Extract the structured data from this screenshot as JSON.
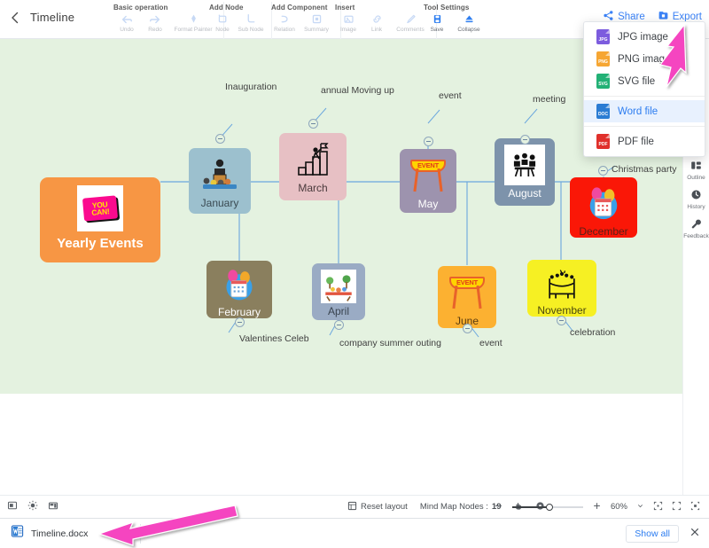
{
  "header": {
    "back_icon": "chevron-left-icon",
    "title": "Timeline",
    "share_label": "Share",
    "export_label": "Export",
    "share_icon": "share-icon",
    "export_icon": "export-folder-icon",
    "groups": [
      {
        "title": "Basic operation",
        "items": [
          {
            "label": "Undo",
            "icon": "undo-arrow-icon",
            "enabled": false
          },
          {
            "label": "Redo",
            "icon": "redo-arrow-icon",
            "enabled": false
          },
          {
            "label": "Format Painter",
            "icon": "format-painter-icon",
            "enabled": false
          }
        ]
      },
      {
        "title": "Add Node",
        "items": [
          {
            "label": "Node",
            "icon": "add-node-icon",
            "enabled": false
          },
          {
            "label": "Sub Node",
            "icon": "add-subnode-icon",
            "enabled": false
          }
        ]
      },
      {
        "title": "Add Component",
        "items": [
          {
            "label": "Relation",
            "icon": "relation-icon",
            "enabled": false
          },
          {
            "label": "Summary",
            "icon": "summary-icon",
            "enabled": false
          }
        ]
      },
      {
        "title": "Insert",
        "items": [
          {
            "label": "Image",
            "icon": "image-icon",
            "enabled": false
          },
          {
            "label": "Link",
            "icon": "link-icon",
            "enabled": false
          },
          {
            "label": "Comments",
            "icon": "comments-icon",
            "enabled": false
          }
        ]
      },
      {
        "title": "Tool Settings",
        "items": [
          {
            "label": "Save",
            "icon": "save-disk-icon",
            "enabled": true
          },
          {
            "label": "Collapse",
            "icon": "collapse-icon",
            "enabled": true
          }
        ]
      }
    ]
  },
  "export_menu": {
    "items": [
      {
        "label": "JPG image",
        "icon": "jpg-file-icon",
        "color": "#7c5cde",
        "tag": "JPG",
        "selected": false
      },
      {
        "label": "PNG image",
        "icon": "png-file-icon",
        "color": "#f6a633",
        "tag": "PNG",
        "selected": false
      },
      {
        "label": "SVG file",
        "icon": "svg-file-icon",
        "color": "#23b176",
        "tag": "SVG",
        "selected": false
      },
      {
        "label": "Word file",
        "icon": "word-file-icon",
        "color": "#2b7cd3",
        "tag": "DOC",
        "selected": true
      },
      {
        "label": "PDF file",
        "icon": "pdf-file-icon",
        "color": "#e0302b",
        "tag": "PDF",
        "selected": false
      }
    ]
  },
  "right_rail": {
    "items": [
      {
        "label": "Outline",
        "icon": "outline-icon"
      },
      {
        "label": "History",
        "icon": "clock-history-icon"
      },
      {
        "label": "Feedback",
        "icon": "wrench-feedback-icon"
      }
    ]
  },
  "mindmap": {
    "central": {
      "label": "Yearly Events",
      "color": "#f79644",
      "image": "you-can-poster"
    },
    "nodes": [
      {
        "label": "January",
        "color": "#9cc0ce",
        "text_color": "#3a4a52",
        "image": "speaker-podium"
      },
      {
        "label": "March",
        "color": "#e7c0c4",
        "text_color": "#4a3a3c",
        "image": "achievement-steps"
      },
      {
        "label": "May",
        "color": "#9d93ae",
        "text_color": "#ffffff",
        "image": "event-banner"
      },
      {
        "label": "August",
        "color": "#7d93ab",
        "text_color": "#ffffff",
        "image": "meeting-people"
      },
      {
        "label": "December",
        "color": "#fa1707",
        "text_color": "#5c2018",
        "image": "calendar-balloons"
      },
      {
        "label": "February",
        "color": "#8a7f5e",
        "text_color": "#ffffff",
        "image": "calendar-balloons"
      },
      {
        "label": "April",
        "color": "#9aabc4",
        "text_color": "#3a4450",
        "image": "picnic-outing"
      },
      {
        "label": "June",
        "color": "#fcb131",
        "text_color": "#5a3b10",
        "image": "event-banner"
      },
      {
        "label": "November",
        "color": "#f6f023",
        "text_color": "#4d4a0e",
        "image": "party-celebration"
      }
    ],
    "annotations": [
      "Inauguration",
      "annual Moving up",
      "event",
      "meeting",
      "Christmas party",
      "Valentines Celeb",
      "company summer outing",
      "event",
      "celebration"
    ]
  },
  "status_bar": {
    "left_icons": [
      "note-panel-icon",
      "theme-brightness-icon",
      "layout-style-icon"
    ],
    "reset_layout_label": "Reset layout",
    "reset_layout_icon": "reset-layout-icon",
    "node_count_label": "Mind Map Nodes :",
    "node_count_value": "19",
    "hand_tool_icon": "hand-tool-icon",
    "pointer-tool_icon": "pointer-tool-icon",
    "zoom_out_icon": "minus-icon",
    "zoom_in_icon": "plus-icon",
    "zoom_value": "60%",
    "zoom_caret_icon": "chevron-down-icon",
    "fit_icon": "fit-screen-icon",
    "fullscreen_icon": "fullscreen-icon",
    "center_icon": "center-view-icon"
  },
  "download_bar": {
    "file_name": "Timeline.docx",
    "file_icon": "word-doc-icon",
    "show_all_label": "Show all",
    "close_icon": "close-icon"
  },
  "colors": {
    "canvas_bg": "#e4f2e0",
    "accent_blue": "#3b82f6",
    "highlight_row": "#e8f1fe",
    "annotation_arrow": "#f545c0"
  }
}
